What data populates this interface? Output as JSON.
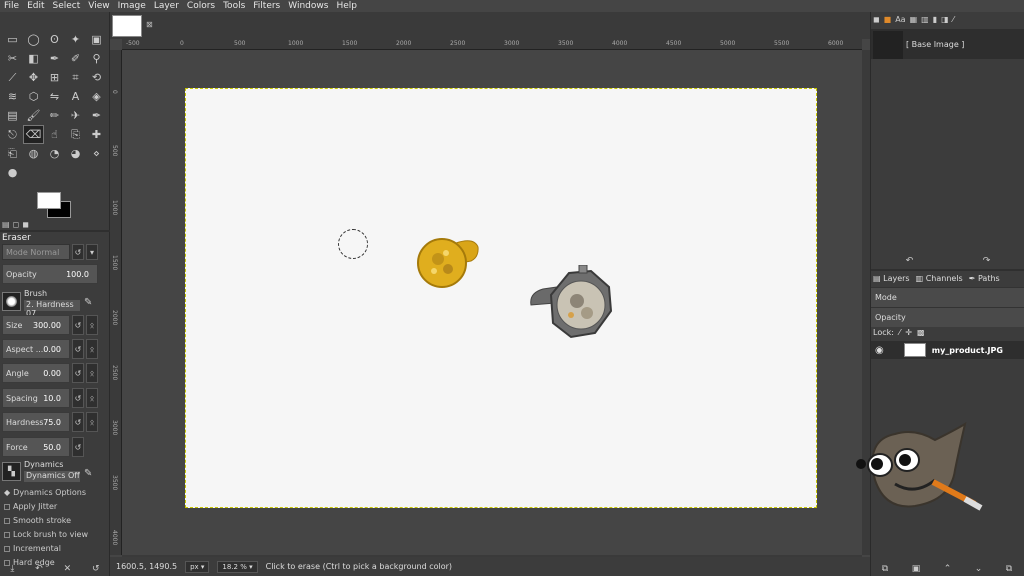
{
  "menu": [
    "File",
    "Edit",
    "Select",
    "View",
    "Image",
    "Layer",
    "Colors",
    "Tools",
    "Filters",
    "Windows",
    "Help"
  ],
  "toolbox": {
    "tool_icons": [
      "rect-select",
      "ellipse-select",
      "free-select",
      "fuzzy-select",
      "by-color-select",
      "scissors",
      "foreground-select",
      "paths",
      "color-picker",
      "zoom",
      "measure",
      "move",
      "align",
      "crop",
      "unified-transform",
      "warp",
      "cage",
      "flip",
      "text",
      "bucket-fill",
      "gradient",
      "paintbrush",
      "pencil",
      "airbrush",
      "ink",
      "mypaint",
      "eraser",
      "smudge",
      "clone",
      "heal",
      "perspective-clone",
      "blur",
      "dodge",
      "burn",
      "dissolve",
      "color-swatch"
    ],
    "options_title": "Eraser",
    "mode_label": "Mode  Normal",
    "opacity_label": "Opacity",
    "opacity_value": "100.0",
    "brush_label": "Brush",
    "brush_value": "2. Hardness 07",
    "size_label": "Size",
    "size_value": "300.00",
    "aspect_label": "Aspect ...",
    "aspect_value": "0.00",
    "angle_label": "Angle",
    "angle_value": "0.00",
    "spacing_label": "Spacing",
    "spacing_value": "10.0",
    "hardness_label": "Hardness",
    "hardness_value": "75.0",
    "force_label": "Force",
    "force_value": "50.0",
    "dynamics_label": "Dynamics",
    "dynamics_value": "Dynamics Off",
    "dynamics_options": "Dynamics Options",
    "checkboxes": [
      "Apply Jitter",
      "Smooth stroke",
      "Lock brush to view",
      "Incremental",
      "Hard edge"
    ]
  },
  "ruler": {
    "h_ticks": [
      "-500",
      "0",
      "500",
      "1000",
      "1500",
      "2000",
      "2500",
      "3000",
      "3500",
      "4000",
      "4500",
      "5000",
      "5500",
      "6000"
    ],
    "v_ticks": [
      "0",
      "500",
      "1000",
      "1500",
      "2000",
      "2500",
      "3000",
      "3500",
      "4000"
    ]
  },
  "status": {
    "coords": "1600.5, 1490.5",
    "unit": "px",
    "zoom": "18.2 %",
    "message": "Click to erase (Ctrl to pick a background color)"
  },
  "undo": {
    "base_label": "[ Base Image ]"
  },
  "layers": {
    "tabs": [
      "Layers",
      "Channels",
      "Paths"
    ],
    "mode_label": "Mode",
    "opacity_label": "Opacity",
    "lock_label": "Lock:",
    "layer_name": "my_product.JPG"
  }
}
